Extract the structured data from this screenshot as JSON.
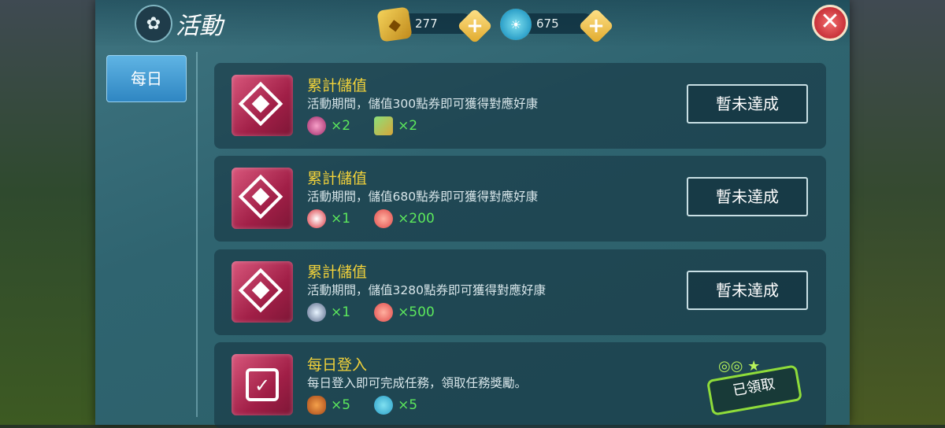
{
  "header": {
    "title": "活動",
    "gems": "277",
    "coins": "675"
  },
  "sidebar": {
    "tabs": [
      {
        "label": "每日"
      }
    ]
  },
  "cards": [
    {
      "title": "累計儲值",
      "desc": "活動期間，儲值300點券即可獲得對應好康",
      "rewards": [
        "×2",
        "×2"
      ],
      "status": "暫未達成"
    },
    {
      "title": "累計儲值",
      "desc": "活動期間，儲值680點券即可獲得對應好康",
      "rewards": [
        "×1",
        "×200"
      ],
      "status": "暫未達成"
    },
    {
      "title": "累計儲值",
      "desc": "活動期間，儲值3280點券即可獲得對應好康",
      "rewards": [
        "×1",
        "×500"
      ],
      "status": "暫未達成"
    },
    {
      "title": "每日登入",
      "desc": "每日登入即可完成任務，領取任務獎勵。",
      "rewards": [
        "×5",
        "×5"
      ],
      "status": "已領取"
    }
  ],
  "colors": {
    "accent_title": "#f2d23a",
    "reward_count": "#5ce85c",
    "tab_active": "#3f96d0"
  }
}
